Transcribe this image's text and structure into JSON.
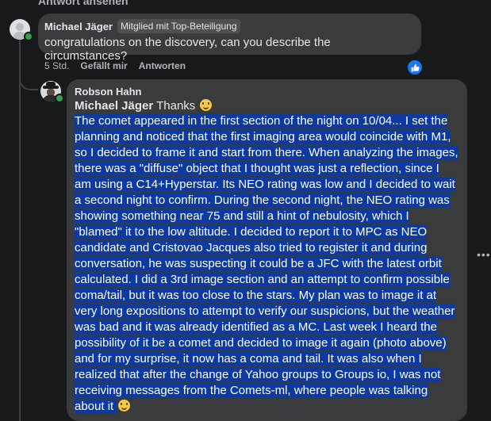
{
  "top_link": "Antwort ansehen",
  "comment1": {
    "author": "Michael Jäger",
    "badge": "Mitglied mit Top-Beteiligung",
    "text": "congratulations on the discovery, can you describe the circumstances?",
    "time": "5 Std.",
    "like_label": "Gefällt mir",
    "reply_label": "Antworten",
    "reaction_icon": "thumbs-up-icon"
  },
  "comment2": {
    "author": "Robson Hahn",
    "mention": "Michael Jäger",
    "greeting": " Thanks ",
    "lines": [
      "The comet appeared in the first section of the night on 10/04... I set the",
      "planning and noticed that the first imaging area would coincide with M1,",
      "so I decided to frame it and start from there. When analyzing the images,",
      "there was a \"diffuse\" object that I thought was just a reflection, since I",
      "am using a C14+Hyperstar. Its NEO rating was low and I decided to wait",
      "a second night to confirm. During the second night, the NEO rating was",
      "showing something near 75 and still a hint of nebulosity, which I",
      "\"blamed\" it to the low altitude. I decided to report it to MPC as NEO",
      "candidate and Cristovao Jacques also tried to register it and during",
      "conversation, he was suspecting it could be a JFC with the latest orbit",
      "calculated. I did a 3rd image section and an attempt to confirm possible",
      "coma/tail, but it was too close to the stars. My plan was to image it at",
      "very long expositions to attempt to verify our suspicions, but the weather",
      "was bad and it was already identified as a MC. Last week I heard the",
      "possibility of it be a comet and decided to image it again (photo above)",
      "and for my surprise, it now has a coma and tail. It was also when I",
      "realized that after the change of Yahoo groups to Groups io, I was not",
      "receiving messages from the Comets-ml, where people was talking",
      "about it "
    ]
  },
  "colors": {
    "background": "#18191a",
    "bubble": "#3a3b3c",
    "highlight": "#0d3aa1",
    "like_blue": "#1877f2",
    "online_green": "#31a24c"
  }
}
